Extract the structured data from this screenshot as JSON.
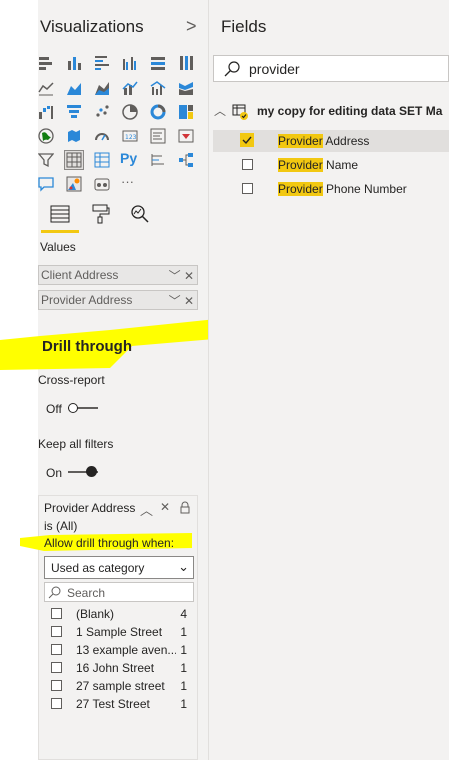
{
  "visualizations": {
    "title": "Visualizations",
    "expand_glyph": ">",
    "py_label": "Py",
    "more_glyph": "···",
    "values_label": "Values",
    "wells": [
      {
        "label": "Client Address"
      },
      {
        "label": "Provider Address"
      }
    ],
    "drill_through": {
      "title": "Drill through",
      "cross_report_label": "Cross-report",
      "cross_report_state": "Off",
      "keep_filters_label": "Keep all filters",
      "keep_filters_state": "On"
    },
    "filter_card": {
      "field_name": "Provider Address",
      "condition": "is (All)",
      "allow_label": "Allow drill through when:",
      "dropdown_value": "Used as category",
      "search_placeholder": "Search",
      "items": [
        {
          "label": "(Blank)",
          "count": "4"
        },
        {
          "label": "1 Sample Street",
          "count": "1"
        },
        {
          "label": "13 example aven...",
          "count": "1"
        },
        {
          "label": "16 John Street",
          "count": "1"
        },
        {
          "label": "27 sample street",
          "count": "1"
        },
        {
          "label": "27 Test Street",
          "count": "1"
        }
      ]
    }
  },
  "fields": {
    "title": "Fields",
    "search_value": "provider",
    "table_name": "my copy for editing data SET Ma",
    "items": [
      {
        "match": "Provider",
        "rest": " Address",
        "checked": true
      },
      {
        "match": "Provider",
        "rest": " Name",
        "checked": false
      },
      {
        "match": "Provider",
        "rest": " Phone Number",
        "checked": false
      }
    ]
  },
  "colors": {
    "pane_bg": "#f3f2f1",
    "accent_yellow": "#f2c811",
    "annotation_yellow": "#ffff00",
    "selected_row": "#e1dfdd"
  }
}
